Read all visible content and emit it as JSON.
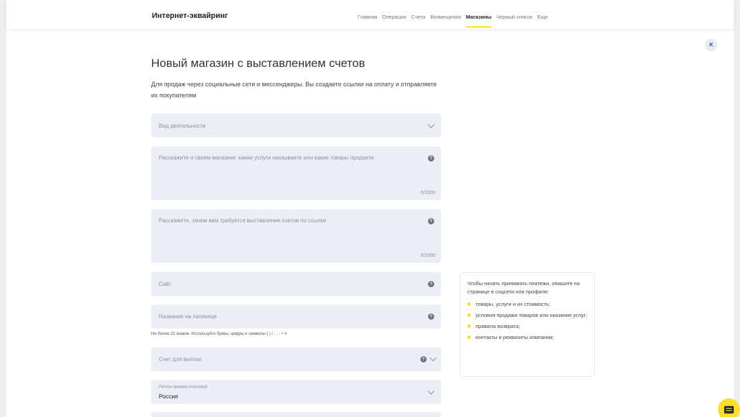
{
  "header": {
    "brand": "Интернет-эквайринг",
    "nav": [
      {
        "label": "Главная",
        "active": false
      },
      {
        "label": "Операции",
        "active": false
      },
      {
        "label": "Счета",
        "active": false
      },
      {
        "label": "Возмещения",
        "active": false
      },
      {
        "label": "Магазины",
        "active": true
      },
      {
        "label": "Черный список",
        "active": false
      },
      {
        "label": "Еще",
        "active": false
      }
    ]
  },
  "close_icon": "×",
  "title": "Новый магазин с выставлением счетов",
  "subtitle": "Для продаж через социальные сети и мессенджеры. Вы создаете ссылки на оплату и отправляете их покупателям",
  "form": {
    "activity_type": {
      "placeholder": "Вид деятельности"
    },
    "store_description": {
      "placeholder": "Расскажите о своем магазине: какие услуги оказываете или какие товары продаете",
      "counter": "0/1000"
    },
    "invoice_reason": {
      "placeholder": "Расскажите, зачем вам требуется выставление счетов по ссылке",
      "counter": "0/1000"
    },
    "site": {
      "placeholder": "Сайт"
    },
    "latin_name": {
      "placeholder": "Название на латинице",
      "hint": "Не более 22 знаков. Используйте буквы, цифры и символы ( ) / . , - + #"
    },
    "payout_account": {
      "placeholder": "Счет для выплат"
    },
    "region": {
      "label": "Регион приема платежей",
      "value": "Россия"
    }
  },
  "info_card": {
    "intro": "Чтобы начать принимать платежи, опишите на странице в соцсети или профиле:",
    "items": [
      "товары, услуги и их стоимость;",
      "условия продажи товаров или оказания услуг;",
      "правила возврата;",
      "контакты и реквизиты компании;"
    ]
  },
  "help_glyph": "?",
  "colors": {
    "accent": "#ffdd2d",
    "field_bg": "#ebeef4",
    "close_bg": "#e7ebf2"
  },
  "icons": {
    "close": "close-icon",
    "help": "help-icon",
    "chevron": "chevron-down-icon",
    "chat": "chat-icon"
  }
}
